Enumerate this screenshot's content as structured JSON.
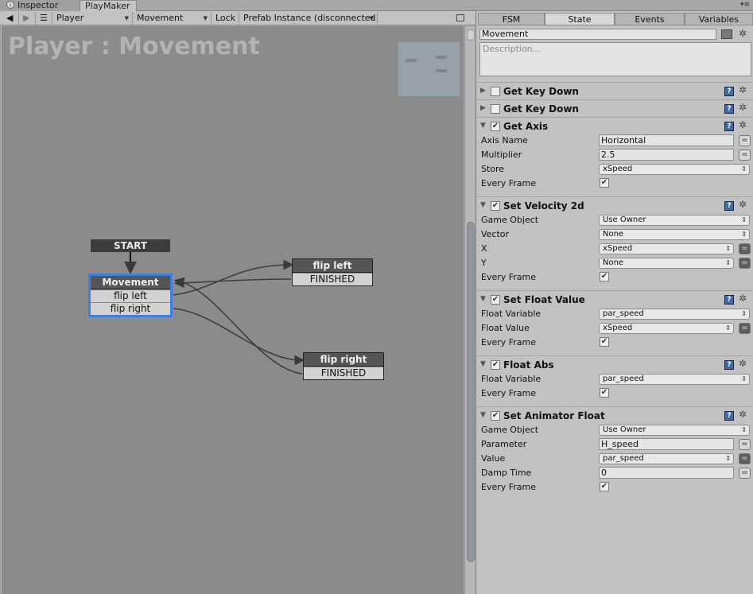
{
  "window_tabs": [
    {
      "label": "Inspector",
      "icon": "info-icon"
    },
    {
      "label": "PlayMaker",
      "icon": ""
    }
  ],
  "toolbar": {
    "back_icon": "arrow-left-icon",
    "forward_icon": "arrow-right-icon",
    "menu_icon": "list-icon",
    "gameobject": "Player",
    "fsm": "Movement",
    "lock_label": "Lock",
    "prefab_status": "Prefab Instance (disconnected)",
    "fullscreen_icon": "maximize-icon"
  },
  "graph": {
    "title": "Player : Movement",
    "start_label": "START",
    "nodes": {
      "movement": {
        "title": "Movement",
        "transitions": [
          "flip left",
          "flip right"
        ]
      },
      "flip_left": {
        "title": "flip left",
        "transitions": [
          "FINISHED"
        ]
      },
      "flip_right": {
        "title": "flip right",
        "transitions": [
          "FINISHED"
        ]
      }
    }
  },
  "inspector": {
    "tabs": [
      "FSM",
      "State",
      "Events",
      "Variables"
    ],
    "active_tab": "State",
    "state_name": "Movement",
    "description_placeholder": "Description...",
    "actions": [
      {
        "title": "Get Key Down",
        "expanded": false,
        "enabled": false,
        "params": []
      },
      {
        "title": "Get Key Down",
        "expanded": false,
        "enabled": false,
        "params": []
      },
      {
        "title": "Get Axis",
        "expanded": true,
        "enabled": true,
        "params": [
          {
            "label": "Axis Name",
            "kind": "field",
            "value": "Horizontal",
            "btn": "plain"
          },
          {
            "label": "Multiplier",
            "kind": "field",
            "value": "2.5",
            "btn": "plain"
          },
          {
            "label": "Store",
            "kind": "drop",
            "value": "xSpeed",
            "btn": ""
          },
          {
            "label": "Every Frame",
            "kind": "check",
            "value": "✔",
            "btn": ""
          }
        ]
      },
      {
        "title": "Set Velocity 2d",
        "expanded": true,
        "enabled": true,
        "params": [
          {
            "label": "Game Object",
            "kind": "drop",
            "value": "Use Owner",
            "btn": ""
          },
          {
            "label": "Vector",
            "kind": "drop",
            "value": "None",
            "btn": ""
          },
          {
            "label": "X",
            "kind": "drop",
            "value": "xSpeed",
            "btn": "dark"
          },
          {
            "label": "Y",
            "kind": "drop",
            "value": "None",
            "btn": "dark"
          },
          {
            "label": "Every Frame",
            "kind": "check",
            "value": "✔",
            "btn": ""
          }
        ]
      },
      {
        "title": "Set Float Value",
        "expanded": true,
        "enabled": true,
        "params": [
          {
            "label": "Float Variable",
            "kind": "drop",
            "value": "par_speed",
            "btn": ""
          },
          {
            "label": "Float Value",
            "kind": "drop",
            "value": "xSpeed",
            "btn": "dark"
          },
          {
            "label": "Every Frame",
            "kind": "check",
            "value": "✔",
            "btn": ""
          }
        ]
      },
      {
        "title": "Float Abs",
        "expanded": true,
        "enabled": true,
        "params": [
          {
            "label": "Float Variable",
            "kind": "drop",
            "value": "par_speed",
            "btn": ""
          },
          {
            "label": "Every Frame",
            "kind": "check",
            "value": "✔",
            "btn": ""
          }
        ]
      },
      {
        "title": "Set Animator Float",
        "expanded": true,
        "enabled": true,
        "params": [
          {
            "label": "Game Object",
            "kind": "drop",
            "value": "Use Owner",
            "btn": ""
          },
          {
            "label": "Parameter",
            "kind": "field",
            "value": "H_speed",
            "btn": "plain"
          },
          {
            "label": "Value",
            "kind": "drop",
            "value": "par_speed",
            "btn": "dark"
          },
          {
            "label": "Damp Time",
            "kind": "field",
            "value": "0",
            "btn": "plain"
          },
          {
            "label": "Every Frame",
            "kind": "check",
            "value": "✔",
            "btn": ""
          }
        ]
      }
    ]
  }
}
